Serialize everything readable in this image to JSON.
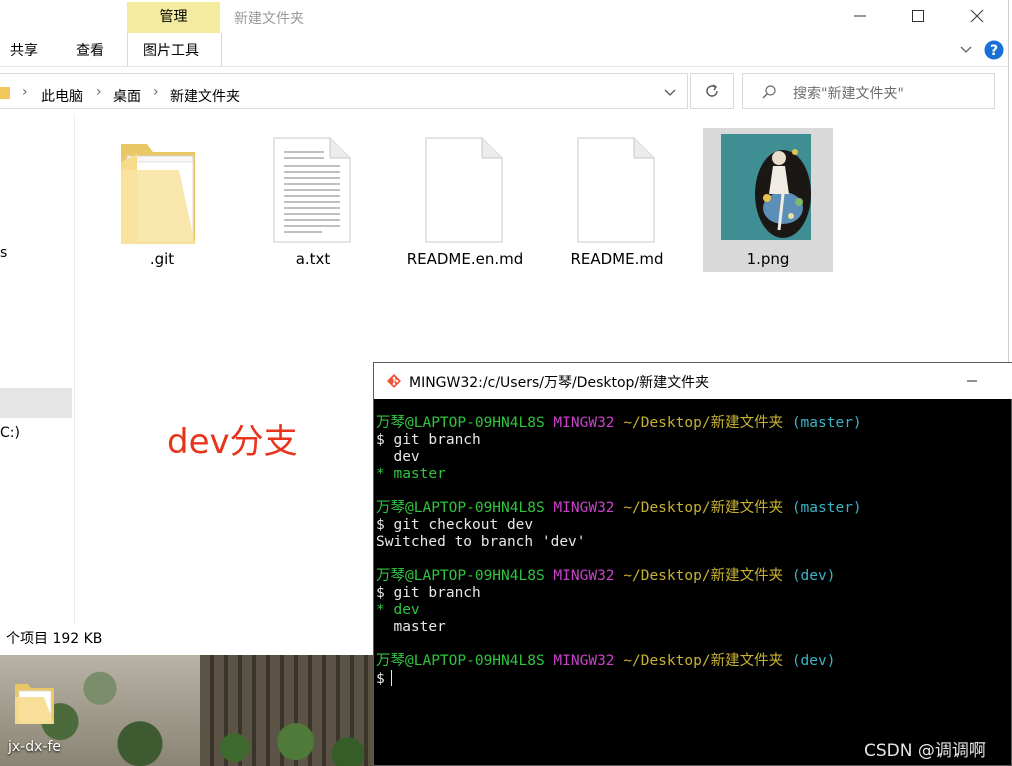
{
  "explorer": {
    "window_title": "新建文件夹",
    "ribbon_context_header": "管理",
    "tabs": [
      "共享",
      "查看",
      "图片工具"
    ],
    "breadcrumb": [
      "此电脑",
      "桌面",
      "新建文件夹"
    ],
    "search_placeholder": "搜索\"新建文件夹\"",
    "nav_fragments": [
      "s",
      "C:)"
    ],
    "status_text": "个项目  192 KB",
    "files": [
      {
        "name": ".git",
        "type": "folder"
      },
      {
        "name": "a.txt",
        "type": "text"
      },
      {
        "name": "README.en.md",
        "type": "blank"
      },
      {
        "name": "README.md",
        "type": "blank"
      },
      {
        "name": "1.png",
        "type": "image",
        "selected": true
      }
    ],
    "annotation": "dev分支"
  },
  "terminal": {
    "title": "MINGW32:/c/Users/万琴/Desktop/新建文件夹",
    "prompt_user": "万琴@LAPTOP-09HN4L8S",
    "prompt_env": "MINGW32",
    "prompt_path": "~/Desktop/新建文件夹",
    "lines": [
      {
        "kind": "prompt",
        "branch": "(master)"
      },
      {
        "kind": "cmd",
        "text": "$ git branch"
      },
      {
        "kind": "out",
        "text": "  dev"
      },
      {
        "kind": "out-current",
        "text": "* master"
      },
      {
        "kind": "blank"
      },
      {
        "kind": "prompt",
        "branch": "(master)"
      },
      {
        "kind": "cmd",
        "text": "$ git checkout dev"
      },
      {
        "kind": "out",
        "text": "Switched to branch 'dev'"
      },
      {
        "kind": "blank"
      },
      {
        "kind": "prompt",
        "branch": "(dev)"
      },
      {
        "kind": "cmd",
        "text": "$ git branch"
      },
      {
        "kind": "out-current",
        "text": "* dev"
      },
      {
        "kind": "out",
        "text": "  master"
      },
      {
        "kind": "blank"
      },
      {
        "kind": "prompt",
        "branch": "(dev)"
      },
      {
        "kind": "input",
        "text": "$"
      }
    ]
  },
  "desktop": {
    "icon_label": "jx-dx-fe"
  },
  "watermark": "CSDN @调调啊",
  "colors": {
    "ribbon_manage": "#f4eba0",
    "annotation": "#e8341c",
    "term_green": "#2fc53f",
    "term_magenta": "#c842c8",
    "term_yellow": "#c7b232",
    "term_cyan": "#3cb4c8"
  }
}
